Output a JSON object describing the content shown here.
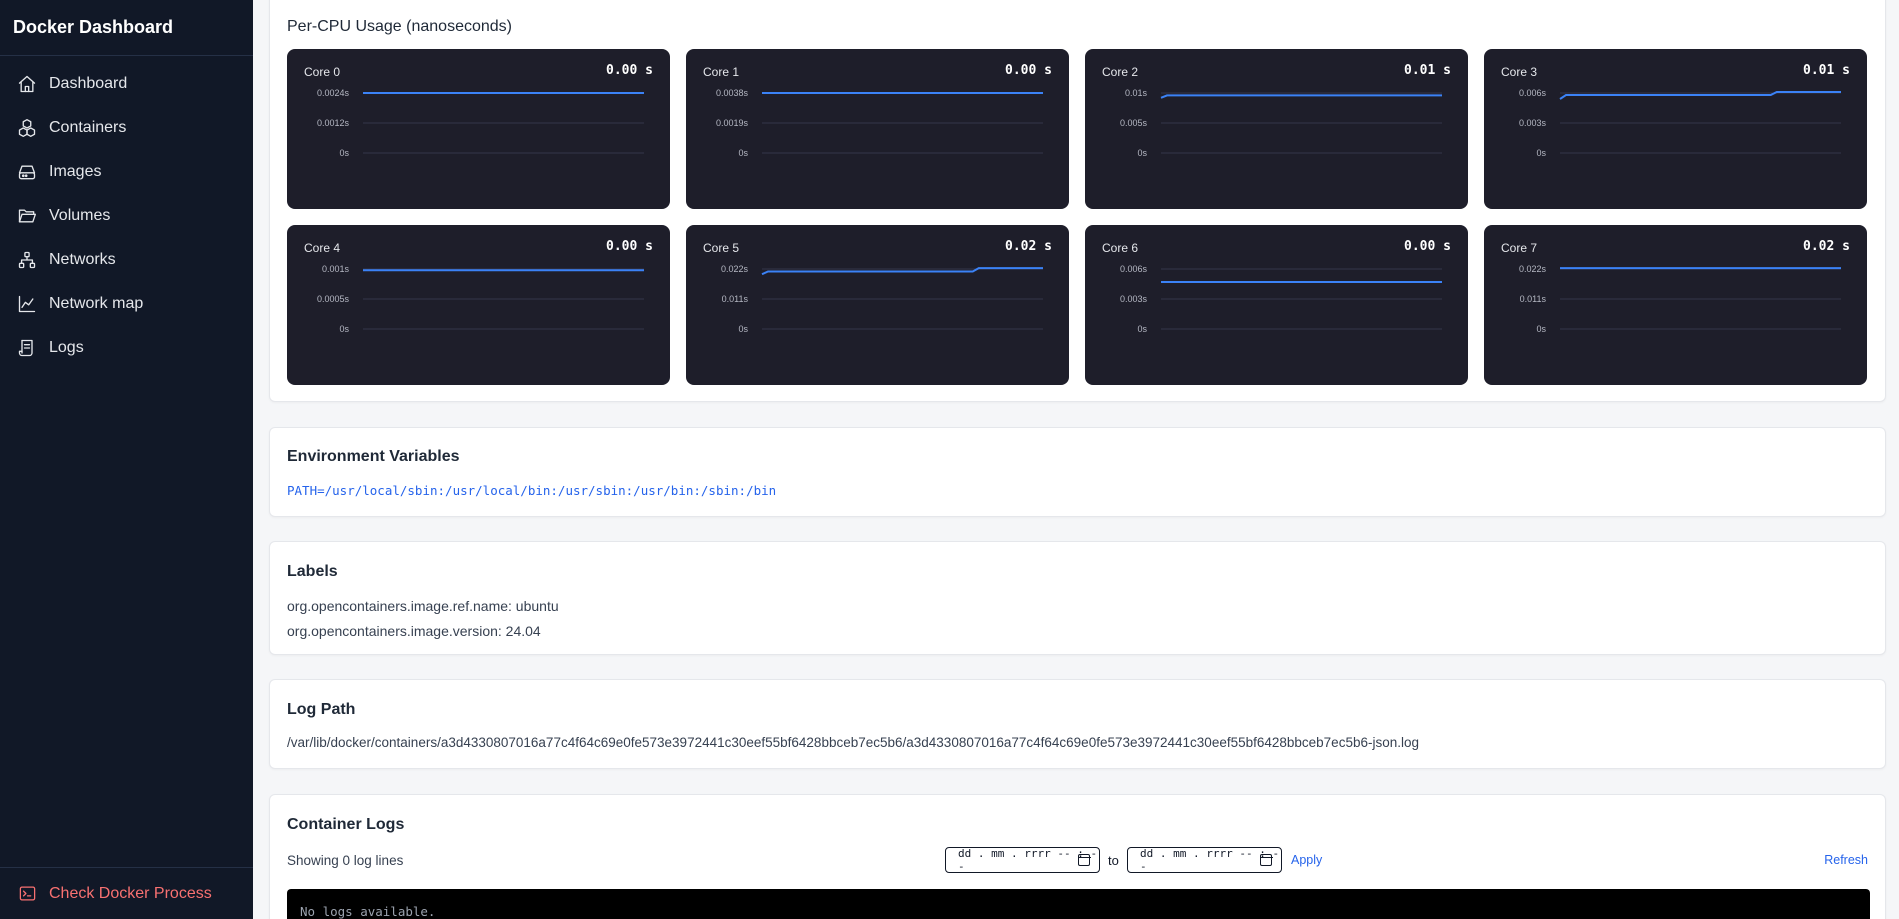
{
  "app": {
    "title": "Docker Dashboard"
  },
  "sidebar": {
    "items": [
      {
        "label": "Dashboard",
        "icon": "home-icon"
      },
      {
        "label": "Containers",
        "icon": "cubes-icon"
      },
      {
        "label": "Images",
        "icon": "drive-icon"
      },
      {
        "label": "Volumes",
        "icon": "folder-icon"
      },
      {
        "label": "Networks",
        "icon": "network-icon"
      },
      {
        "label": "Network map",
        "icon": "chart-icon"
      },
      {
        "label": "Logs",
        "icon": "scroll-icon"
      }
    ],
    "footer": {
      "label": "Check Docker Process",
      "icon": "terminal-icon",
      "color": "#f87171"
    }
  },
  "cpu": {
    "title": "Per-CPU Usage (nanoseconds)",
    "cores": [
      {
        "name": "Core 0",
        "value": "0.00 s",
        "ticks": [
          "0.0024s",
          "0.0012s",
          "0s"
        ]
      },
      {
        "name": "Core 1",
        "value": "0.00 s",
        "ticks": [
          "0.0038s",
          "0.0019s",
          "0s"
        ]
      },
      {
        "name": "Core 2",
        "value": "0.01 s",
        "ticks": [
          "0.01s",
          "0.005s",
          "0s"
        ]
      },
      {
        "name": "Core 3",
        "value": "0.01 s",
        "ticks": [
          "0.006s",
          "0.003s",
          "0s"
        ]
      },
      {
        "name": "Core 4",
        "value": "0.00 s",
        "ticks": [
          "0.001s",
          "0.0005s",
          "0s"
        ]
      },
      {
        "name": "Core 5",
        "value": "0.02 s",
        "ticks": [
          "0.022s",
          "0.011s",
          "0s"
        ]
      },
      {
        "name": "Core 6",
        "value": "0.00 s",
        "ticks": [
          "0.006s",
          "0.003s",
          "0s"
        ]
      },
      {
        "name": "Core 7",
        "value": "0.02 s",
        "ticks": [
          "0.022s",
          "0.011s",
          "0s"
        ]
      }
    ]
  },
  "chart_data": [
    {
      "type": "line",
      "title": "Core 0",
      "ylim": [
        0,
        0.0024
      ],
      "yticks": [
        "0.0024s",
        "0.0012s",
        "0s"
      ],
      "grid": true,
      "series": [
        {
          "values": [
            0.0024,
            0.0024,
            0.0024,
            0.0024,
            0.0024,
            0.0024
          ]
        }
      ]
    },
    {
      "type": "line",
      "title": "Core 1",
      "ylim": [
        0,
        0.0038
      ],
      "yticks": [
        "0.0038s",
        "0.0019s",
        "0s"
      ],
      "grid": true,
      "series": [
        {
          "values": [
            0.0038,
            0.0038,
            0.0038,
            0.0038,
            0.0038,
            0.0038
          ]
        }
      ]
    },
    {
      "type": "line",
      "title": "Core 2",
      "ylim": [
        0,
        0.01
      ],
      "yticks": [
        "0.01s",
        "0.005s",
        "0s"
      ],
      "grid": true,
      "series": [
        {
          "values": [
            0.0092,
            0.0096,
            0.0096,
            0.0096,
            0.0096,
            0.0096,
            0.0096,
            0.0096,
            0.0096
          ]
        }
      ]
    },
    {
      "type": "line",
      "title": "Core 3",
      "ylim": [
        0,
        0.006
      ],
      "yticks": [
        "0.006s",
        "0.003s",
        "0s"
      ],
      "grid": true,
      "series": [
        {
          "values": [
            0.0054,
            0.0058,
            0.0058,
            0.0058,
            0.0058,
            0.0058,
            0.0058,
            0.0061,
            0.0061
          ]
        }
      ]
    },
    {
      "type": "line",
      "title": "Core 4",
      "ylim": [
        0,
        0.001
      ],
      "yticks": [
        "0.001s",
        "0.0005s",
        "0s"
      ],
      "grid": true,
      "series": [
        {
          "values": [
            0.00098,
            0.00098,
            0.00098,
            0.00098,
            0.00098,
            0.00098
          ]
        }
      ]
    },
    {
      "type": "line",
      "title": "Core 5",
      "ylim": [
        0,
        0.022
      ],
      "yticks": [
        "0.022s",
        "0.011s",
        "0s"
      ],
      "grid": true,
      "series": [
        {
          "values": [
            0.0201,
            0.0211,
            0.0211,
            0.0211,
            0.0211,
            0.0211,
            0.0211,
            0.0223,
            0.0223
          ]
        }
      ]
    },
    {
      "type": "line",
      "title": "Core 6",
      "ylim": [
        0,
        0.006
      ],
      "yticks": [
        "0.006s",
        "0.003s",
        "0s"
      ],
      "grid": true,
      "series": [
        {
          "values": [
            0.0047,
            0.0047,
            0.0047,
            0.0047,
            0.0047,
            0.0047
          ]
        }
      ]
    },
    {
      "type": "line",
      "title": "Core 7",
      "ylim": [
        0,
        0.022
      ],
      "yticks": [
        "0.022s",
        "0.011s",
        "0s"
      ],
      "grid": true,
      "series": [
        {
          "values": [
            0.0223,
            0.0223,
            0.0223,
            0.0223,
            0.0223,
            0.0223
          ]
        }
      ]
    }
  ],
  "env": {
    "title": "Environment Variables",
    "vars": [
      "PATH=/usr/local/sbin:/usr/local/bin:/usr/sbin:/usr/bin:/sbin:/bin"
    ]
  },
  "labels": {
    "title": "Labels",
    "items": [
      "org.opencontainers.image.ref.name: ubuntu",
      "org.opencontainers.image.version: 24.04"
    ]
  },
  "log_path": {
    "title": "Log Path",
    "path": "/var/lib/docker/containers/a3d4330807016a77c4f64c69e0fe573e3972441c30eef55bf6428bbceb7ec5b6/a3d4330807016a77c4f64c69e0fe573e3972441c30eef55bf6428bbceb7ec5b6-json.log"
  },
  "container_logs": {
    "title": "Container Logs",
    "count_text": "Showing 0 log lines",
    "from_placeholder": "dd . mm . rrrr  -- : --",
    "to_label": "to",
    "to_placeholder": "dd . mm . rrrr  -- : --",
    "apply_label": "Apply",
    "refresh_label": "Refresh",
    "empty_text": "No logs available."
  },
  "colors": {
    "sidebar_bg": "#111827",
    "accent": "#2563eb",
    "line": "#3b82f6",
    "panel_bg": "#1e1e2a",
    "danger": "#f87171"
  }
}
